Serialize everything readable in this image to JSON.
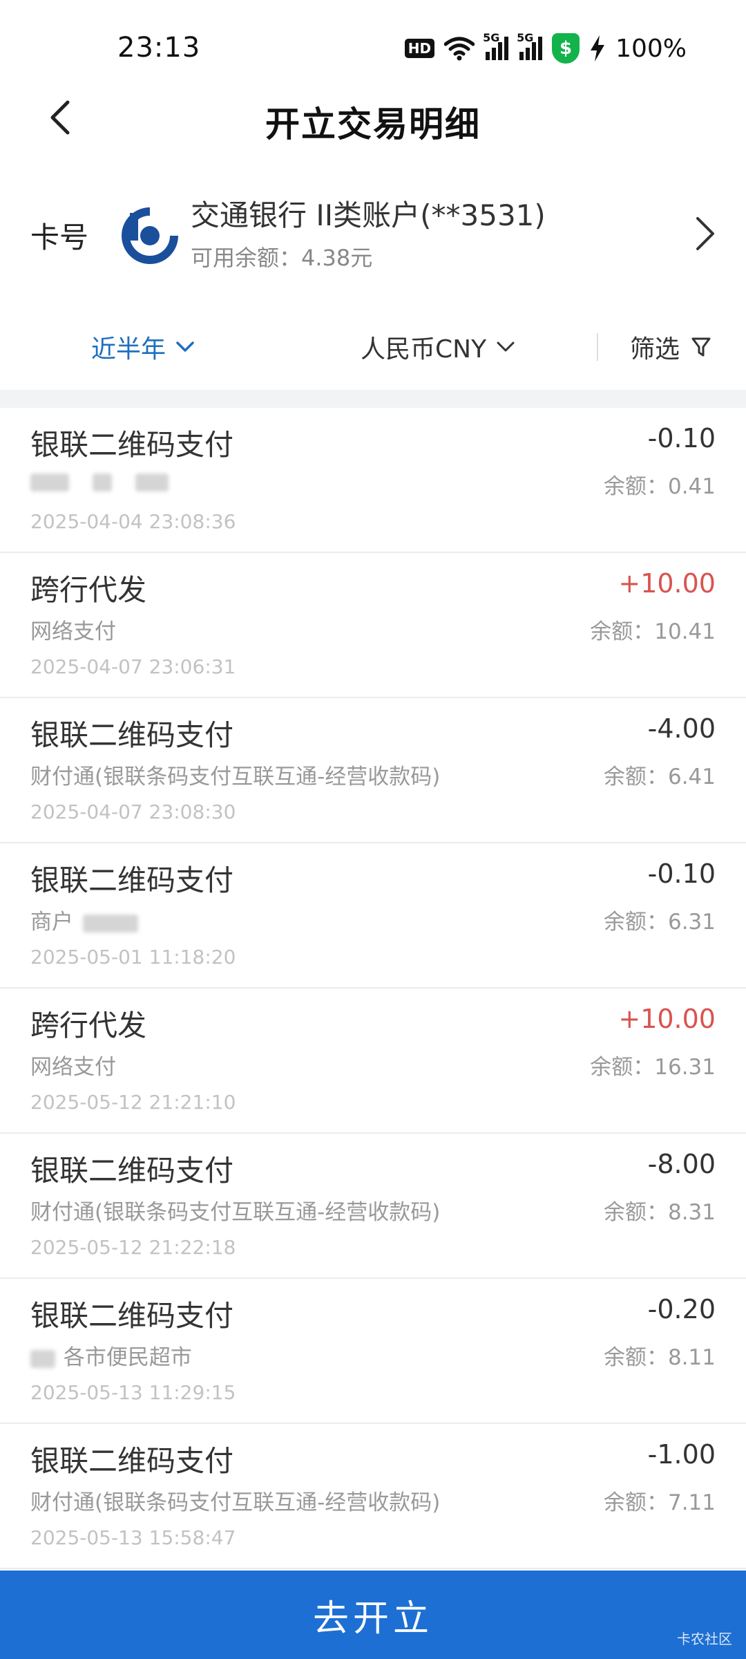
{
  "status": {
    "time": "23:13",
    "battery": "100%",
    "hd_label": "HD",
    "net_label_1": "5G",
    "net_label_2": "5G",
    "security_glyph": "$"
  },
  "header": {
    "title": "开立交易明细"
  },
  "card": {
    "label": "卡号",
    "bank_name": "交通银行 II类账户(**3531)",
    "balance_text": "可用余额：4.38元"
  },
  "filters": {
    "period": "近半年",
    "currency": "人民币CNY",
    "screen": "筛选"
  },
  "transactions": [
    {
      "title": "银联二维码支付",
      "subtitle": "",
      "amount": "-0.10",
      "balance": "余额：0.41",
      "date": "2025-04-04 23:08:36"
    },
    {
      "title": "跨行代发",
      "subtitle": "网络支付",
      "amount": "+10.00",
      "balance": "余额：10.41",
      "date": "2025-04-07 23:06:31"
    },
    {
      "title": "银联二维码支付",
      "subtitle": "财付通(银联条码支付互联互通-经营收款码)",
      "amount": "-4.00",
      "balance": "余额：6.41",
      "date": "2025-04-07 23:08:30"
    },
    {
      "title": "银联二维码支付",
      "subtitle": "商户",
      "amount": "-0.10",
      "balance": "余额：6.31",
      "date": "2025-05-01 11:18:20"
    },
    {
      "title": "跨行代发",
      "subtitle": "网络支付",
      "amount": "+10.00",
      "balance": "余额：16.31",
      "date": "2025-05-12 21:21:10"
    },
    {
      "title": "银联二维码支付",
      "subtitle": "财付通(银联条码支付互联互通-经营收款码)",
      "amount": "-8.00",
      "balance": "余额：8.31",
      "date": "2025-05-12 21:22:18"
    },
    {
      "title": "银联二维码支付",
      "subtitle": "各市便民超市",
      "amount": "-0.20",
      "balance": "余额：8.11",
      "date": "2025-05-13 11:29:15"
    },
    {
      "title": "银联二维码支付",
      "subtitle": "财付通(银联条码支付互联互通-经营收款码)",
      "amount": "-1.00",
      "balance": "余额：7.11",
      "date": "2025-05-13 15:58:47"
    }
  ],
  "bottom_button": "去开立",
  "watermark": "卡农社区",
  "colors": {
    "accent": "#1c6fbf",
    "button": "#1d6fd3",
    "credit": "#d9534f",
    "security": "#12b34a"
  }
}
